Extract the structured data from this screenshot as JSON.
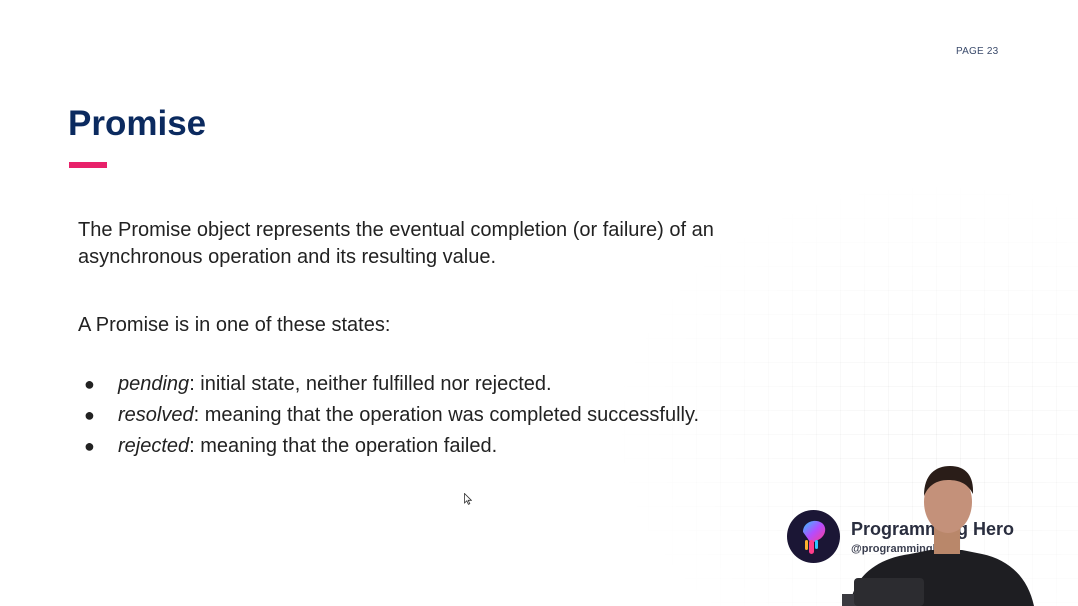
{
  "slide": {
    "page_label": "PAGE 23",
    "title": "Promise",
    "accent_color": "#e8216a",
    "title_color": "#0b2a5f",
    "description": "The Promise object represents the eventual completion (or failure) of an asynchronous operation and its resulting value.",
    "states_intro": "A Promise is in one of these states:",
    "states": [
      {
        "term": "pending",
        "description": ": initial state, neither fulfilled nor rejected."
      },
      {
        "term": "resolved",
        "description": ": meaning that the operation was completed successfully."
      },
      {
        "term": "rejected",
        "description": ": meaning that the operation failed."
      }
    ],
    "bullet": "●"
  },
  "branding": {
    "name": "Programming Hero",
    "handle": "@programminghero",
    "logo_icon": "brush-drop-logo-icon"
  },
  "overlay": {
    "presenter_icon": "presenter-webcam-icon",
    "cursor_icon": "mouse-pointer-icon"
  }
}
